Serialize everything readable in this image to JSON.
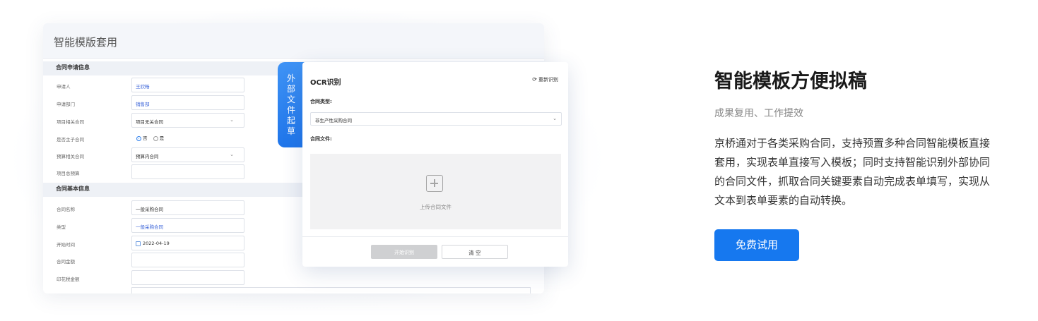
{
  "illustration": {
    "form_title": "智能模版套用",
    "section_apply": "合同申请信息",
    "section_basic": "合同基本信息",
    "rows_apply": [
      {
        "label": "申请人",
        "value": "王欣畅",
        "kind": "blue"
      },
      {
        "label": "申请部门",
        "value": "销售部",
        "kind": "blue"
      },
      {
        "label": "项目相关合同",
        "value": "项目无关合同",
        "kind": "select"
      },
      {
        "label": "是否主子合同",
        "kind": "radio"
      },
      {
        "label": "预算相关合同",
        "value": "预算内合同",
        "kind": "select"
      },
      {
        "label": "项目总预算",
        "value": "",
        "kind": "text"
      }
    ],
    "radio_options": [
      "否",
      "是"
    ],
    "rows_basic": [
      {
        "label": "合同名称",
        "value": "一般采购合同",
        "kind": "text"
      },
      {
        "label": "类型",
        "value": "一般采购合同",
        "kind": "blue"
      },
      {
        "label": "开始时间",
        "value": "2022-04-19",
        "kind": "date"
      },
      {
        "label": "合同金额",
        "value": "",
        "kind": "text"
      },
      {
        "label": "印花税金额",
        "value": "",
        "kind": "text"
      }
    ],
    "side_tab": "外部文件起草",
    "ocr": {
      "title": "OCR识别",
      "reset": "重新识别",
      "type_label": "合同类型:",
      "type_value": "非生产性采购合同",
      "file_label": "合同文件:",
      "upload_text": "上传合同文件",
      "start_button": "开始识别",
      "clear_button": "清 空"
    }
  },
  "content": {
    "headline": "智能模板方便拟稿",
    "subtitle": "成果复用、工作提效",
    "description": "京桥通对于各类采购合同，支持预置多种合同智能模板直接套用，实现表单直接写入模板；同时支持智能识别外部协同的合同文件，抓取合同关键要素自动完成表单填写，实现从文本到表单要素的自动转换。",
    "cta": "免费试用"
  },
  "colors": {
    "accent": "#1678ef",
    "side_tab": "#2a80ee"
  }
}
